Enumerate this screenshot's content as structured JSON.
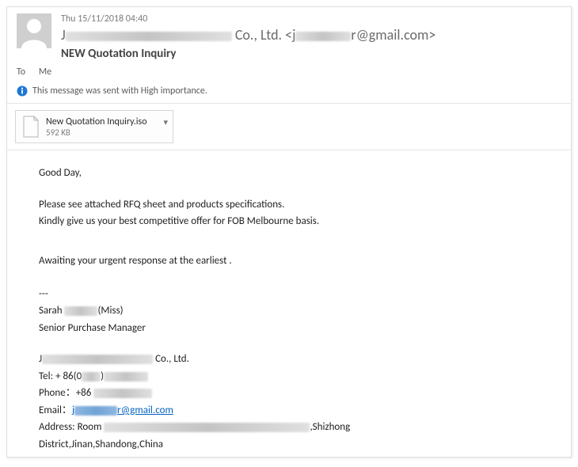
{
  "header": {
    "timestamp": "Thu 15/11/2018 04:40",
    "sender_prefix": "J",
    "sender_suffix": " Co., Ltd. <j",
    "sender_email_suffix": "r@gmail.com>",
    "subject": "NEW Quotation Inquiry"
  },
  "to": {
    "label": "To",
    "recipient": "Me"
  },
  "importance": {
    "text": "This message was sent with High importance."
  },
  "attachment": {
    "name": "New Quotation Inquiry.iso",
    "size": "592 KB"
  },
  "body": {
    "greeting": "Good Day,",
    "line1": "Please see attached RFQ sheet and products specifications.",
    "line2": "Kindly give us your best competitive offer for FOB Melbourne basis.",
    "line3": "Awaiting  your urgent response at the earliest ."
  },
  "signature": {
    "sep": "---",
    "name_prefix": "Sarah ",
    "name_suffix": "(Miss)",
    "title": "Senior Purchase Manager",
    "company_prefix": "J",
    "company_suffix": " Co., Ltd.",
    "tel_label": "Tel: + 86(0",
    "tel_mid": ")",
    "phone_label": "Phone：+86 ",
    "email_label": "Email：",
    "email_link_prefix": "j",
    "email_link_suffix": "r@gmail.com",
    "address_prefix": "Address: Room ",
    "address_suffix": ",Shizhong",
    "address_line2": "District,Jinan,Shandong,China"
  }
}
